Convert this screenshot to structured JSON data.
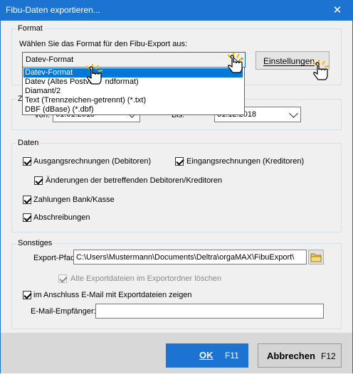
{
  "window": {
    "title": "Fibu-Daten exportieren...",
    "close_glyph": "✕"
  },
  "format": {
    "legend": "Format",
    "prompt": "Wählen Sie das Format für den Fibu-Export aus:",
    "selected": "Datev-Format",
    "settings_button": "Einstellungen",
    "options": [
      "Datev-Format",
      "Datev (Altes Postversandformat)",
      "Diamant/2",
      "Text (Trennzeichen-getrennt) (*.txt)",
      "DBF (dBase) (*.dbf)"
    ],
    "options_visible": [
      "Datev-Format",
      "Datev (Altes Postve",
      "ndformat)",
      "Diamant/2",
      "Text (Trennzeichen-getrennt) (*.txt)",
      "DBF (dBase) (*.dbf)"
    ]
  },
  "zeitraum": {
    "legend_partial": "Ze",
    "von_label": "Von:",
    "von_value": "01.01.2018",
    "bis_label": "Bis:",
    "bis_value": "31.12.2018"
  },
  "daten": {
    "legend": "Daten",
    "ausgangsrechnungen": {
      "label": "Ausgangsrechnungen (Debitoren)",
      "checked": true
    },
    "eingangsrechnungen": {
      "label": "Eingangsrechnungen (Kreditoren)",
      "checked": true
    },
    "aenderungen": {
      "label": "Änderungen der betreffenden Debitoren/Kreditoren",
      "checked": true
    },
    "zahlungen": {
      "label": "Zahlungen Bank/Kasse",
      "checked": true
    },
    "abschreibungen": {
      "label": "Abschreibungen",
      "checked": true
    }
  },
  "sonstiges": {
    "legend": "Sonstiges",
    "export_pfad_label": "Export-Pfad:",
    "export_pfad_value": "C:\\Users\\Mustermann\\Documents\\Deltra\\orgaMAX\\FibuExport\\",
    "alte_loeschen": {
      "label": "Alte Exportdateien im Exportordner löschen",
      "checked": true,
      "enabled": false
    },
    "email_zeigen": {
      "label": "im Anschluss E-Mail mit Exportdateien zeigen",
      "checked": true
    },
    "email_empfaenger_label": "E-Mail-Empfänger:",
    "email_empfaenger_value": ""
  },
  "buttons": {
    "ok_label": "OK",
    "ok_key": "F11",
    "abbrechen_label": "Abbrechen",
    "abbrechen_key": "F12"
  },
  "colors": {
    "titlebar": "#1c73d1",
    "selection": "#0078d7",
    "ok_button": "#1c73d1"
  },
  "icons": [
    "close-icon",
    "folder-icon",
    "hand-cursor-icon",
    "chevron-down-icon"
  ]
}
